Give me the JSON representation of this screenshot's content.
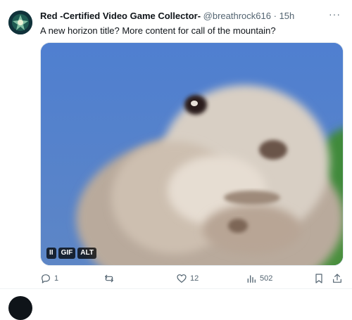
{
  "post": {
    "author_name": "Red -Certified Video Game Collector-",
    "handle": "@breathrock616",
    "separator": "·",
    "time": "15h",
    "more_icon": "more-horizontal-icon",
    "text": "A new horizon title? More content for call of the mountain?",
    "media": {
      "badges": {
        "pause": "II",
        "gif": "GIF",
        "alt": "ALT"
      }
    },
    "actions": {
      "replies": "1",
      "reposts": "",
      "likes": "12",
      "views": "502"
    }
  }
}
